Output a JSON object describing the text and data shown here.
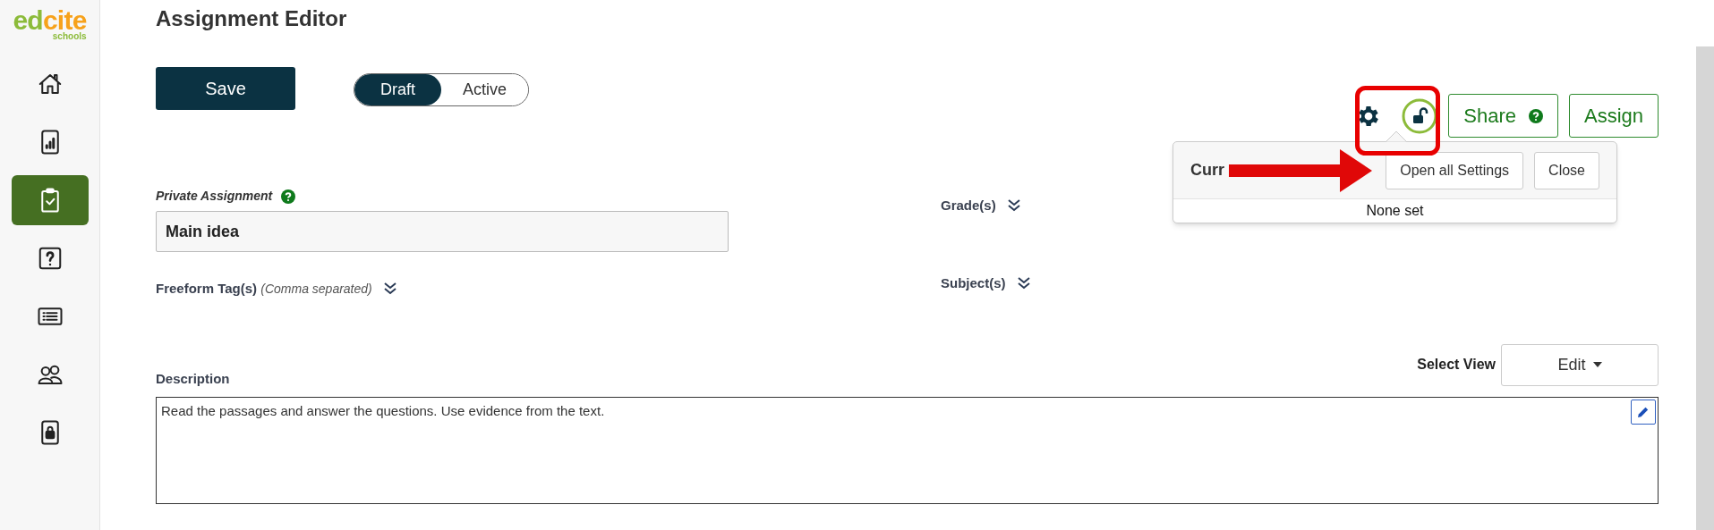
{
  "logo": {
    "part_1": "ed",
    "part_2": "cite",
    "tagline": "schools"
  },
  "sidebar": {
    "items": [
      {
        "kind": "home",
        "selected": false
      },
      {
        "kind": "reports",
        "selected": false
      },
      {
        "kind": "assignments",
        "selected": true
      },
      {
        "kind": "questions",
        "selected": false
      },
      {
        "kind": "list",
        "selected": false
      },
      {
        "kind": "people",
        "selected": false
      },
      {
        "kind": "lock",
        "selected": false
      }
    ]
  },
  "title": "Assignment Editor",
  "save_button": "Save",
  "status_toggle": [
    {
      "label": "Draft",
      "selected": true
    },
    {
      "label": "Active",
      "selected": false
    }
  ],
  "share_button": "Share",
  "assign_button": "Assign",
  "settings_popup": {
    "title": "Curr",
    "buttons": [
      "Open all Settings",
      "Close"
    ],
    "summary": "None set"
  },
  "private_assignment": {
    "label": "Private Assignment",
    "value": "Main idea"
  },
  "grades": {
    "label": "Grade(s)"
  },
  "freeform_tags": {
    "label": "Freeform Tag(s)",
    "hint": "(Comma separated)"
  },
  "subjects": {
    "label": "Subject(s)"
  },
  "select_view": {
    "label": "Select View",
    "value": "Edit"
  },
  "description": {
    "label": "Description",
    "value": "Read the passages and answer the questions.  Use evidence from the text."
  }
}
